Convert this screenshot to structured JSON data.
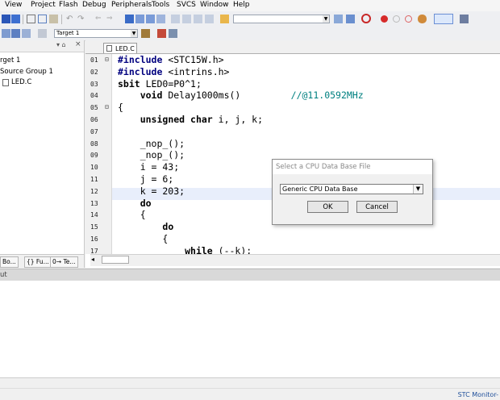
{
  "menu": [
    "View",
    "Project",
    "Flash",
    "Debug",
    "Peripherals",
    "Tools",
    "SVCS",
    "Window",
    "Help"
  ],
  "toolbar2": {
    "target_select": "Target 1"
  },
  "project": {
    "target": "rget 1",
    "group": "Source Group 1",
    "file": "LED.C",
    "tabs": [
      "Bo...",
      "{} Fu...",
      "0→ Te..."
    ]
  },
  "editor": {
    "tab_label": "LED.C",
    "lines": [
      {
        "n": "01",
        "code": "#include <STC15W.h>"
      },
      {
        "n": "02",
        "code": "#include <intrins.h>"
      },
      {
        "n": "03",
        "code": "sbit LED0=P0^1;"
      },
      {
        "n": "04",
        "code": "    void Delay1000ms()         //@11.0592MHz"
      },
      {
        "n": "05",
        "code": "{"
      },
      {
        "n": "06",
        "code": "    unsigned char i, j, k;"
      },
      {
        "n": "07",
        "code": ""
      },
      {
        "n": "08",
        "code": "    _nop_();"
      },
      {
        "n": "09",
        "code": "    _nop_();"
      },
      {
        "n": "10",
        "code": "    i = 43;"
      },
      {
        "n": "11",
        "code": "    j = 6;"
      },
      {
        "n": "12",
        "code": "    k = 203;"
      },
      {
        "n": "13",
        "code": "    do"
      },
      {
        "n": "14",
        "code": "    {"
      },
      {
        "n": "15",
        "code": "        do"
      },
      {
        "n": "16",
        "code": "        {"
      },
      {
        "n": "17",
        "code": "            while (--k);"
      }
    ]
  },
  "output": {
    "label": "ut"
  },
  "status": {
    "right": "STC Monitor-"
  },
  "dialog": {
    "title": "Select a CPU Data Base File",
    "select_value": "Generic CPU Data Base",
    "ok_label": "OK",
    "cancel_label": "Cancel"
  },
  "colors": {
    "accent": "#0a6ed1",
    "highlight_line": "#e8eefb"
  }
}
